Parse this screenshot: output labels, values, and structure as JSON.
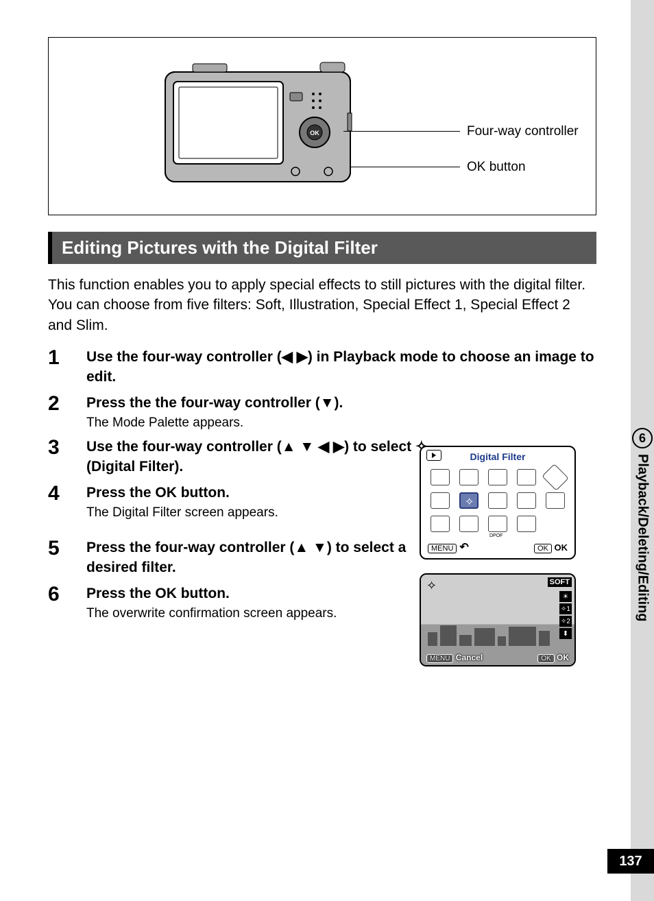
{
  "diagram": {
    "callout1": "Four-way controller",
    "callout2": "OK button"
  },
  "section_title": "Editing Pictures with the Digital Filter",
  "intro": "This function enables you to apply special effects to still pictures with the digital filter. You can choose from five filters: Soft, Illustration, Special Effect 1, Special Effect 2 and Slim.",
  "steps": [
    {
      "n": "1",
      "title_pre": "Use the four-way controller (",
      "arrows": "◀ ▶",
      "title_post": ") in Playback mode to choose an image to edit.",
      "desc": ""
    },
    {
      "n": "2",
      "title_pre": "Press the the four-way controller (",
      "arrows": "▼",
      "title_post": ").",
      "desc": "The Mode Palette appears."
    },
    {
      "n": "3",
      "title_pre": "Use the four-way controller (",
      "arrows": "▲ ▼ ◀ ▶",
      "title_post": ") to select ✧ (Digital Filter).",
      "desc": ""
    },
    {
      "n": "4",
      "title_pre": "Press the OK button.",
      "arrows": "",
      "title_post": "",
      "desc": "The Digital Filter screen appears."
    },
    {
      "n": "5",
      "title_pre": "Press the four-way controller (",
      "arrows": "▲ ▼",
      "title_post": ") to select a desired filter.",
      "desc": ""
    },
    {
      "n": "6",
      "title_pre": "Press the OK button.",
      "arrows": "",
      "title_post": "",
      "desc": "The overwrite confirmation screen appears."
    }
  ],
  "screen1": {
    "title": "Digital Filter",
    "menu": "MENU",
    "ok_badge": "OK",
    "ok_text": "OK",
    "dpof": "DPOF"
  },
  "screen2": {
    "soft": "SOFT",
    "ind1": "✧1",
    "ind2": "✧2",
    "menu": "MENU",
    "cancel": "Cancel",
    "ok_badge": "OK",
    "ok_text": "OK"
  },
  "side": {
    "chapter_num": "6",
    "chapter_title": "Playback/Deleting/Editing"
  },
  "page_number": "137"
}
